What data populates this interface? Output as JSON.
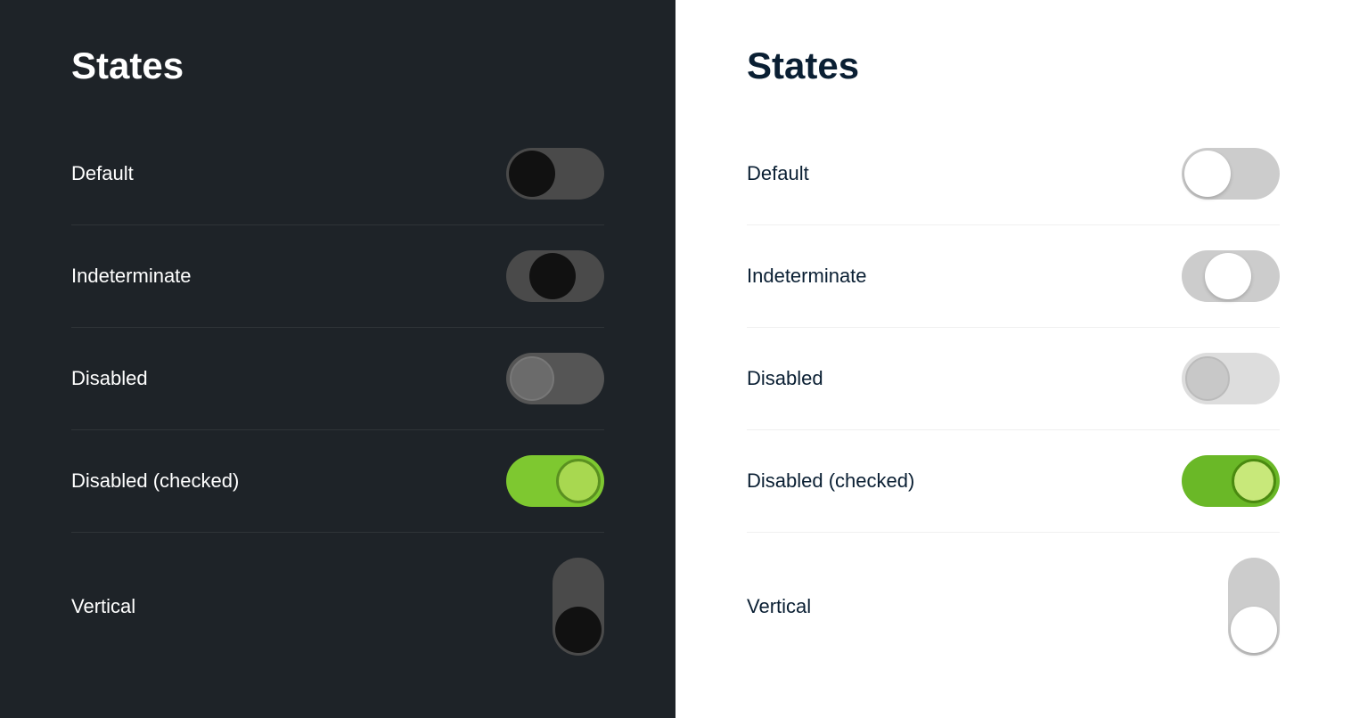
{
  "dark_panel": {
    "title": "States",
    "rows": [
      {
        "id": "default",
        "label": "Default"
      },
      {
        "id": "indeterminate",
        "label": "Indeterminate"
      },
      {
        "id": "disabled",
        "label": "Disabled"
      },
      {
        "id": "disabled-checked",
        "label": "Disabled (checked)"
      },
      {
        "id": "vertical",
        "label": "Vertical"
      }
    ]
  },
  "light_panel": {
    "title": "States",
    "rows": [
      {
        "id": "default",
        "label": "Default"
      },
      {
        "id": "indeterminate",
        "label": "Indeterminate"
      },
      {
        "id": "disabled",
        "label": "Disabled"
      },
      {
        "id": "disabled-checked",
        "label": "Disabled (checked)"
      },
      {
        "id": "vertical",
        "label": "Vertical"
      }
    ]
  }
}
